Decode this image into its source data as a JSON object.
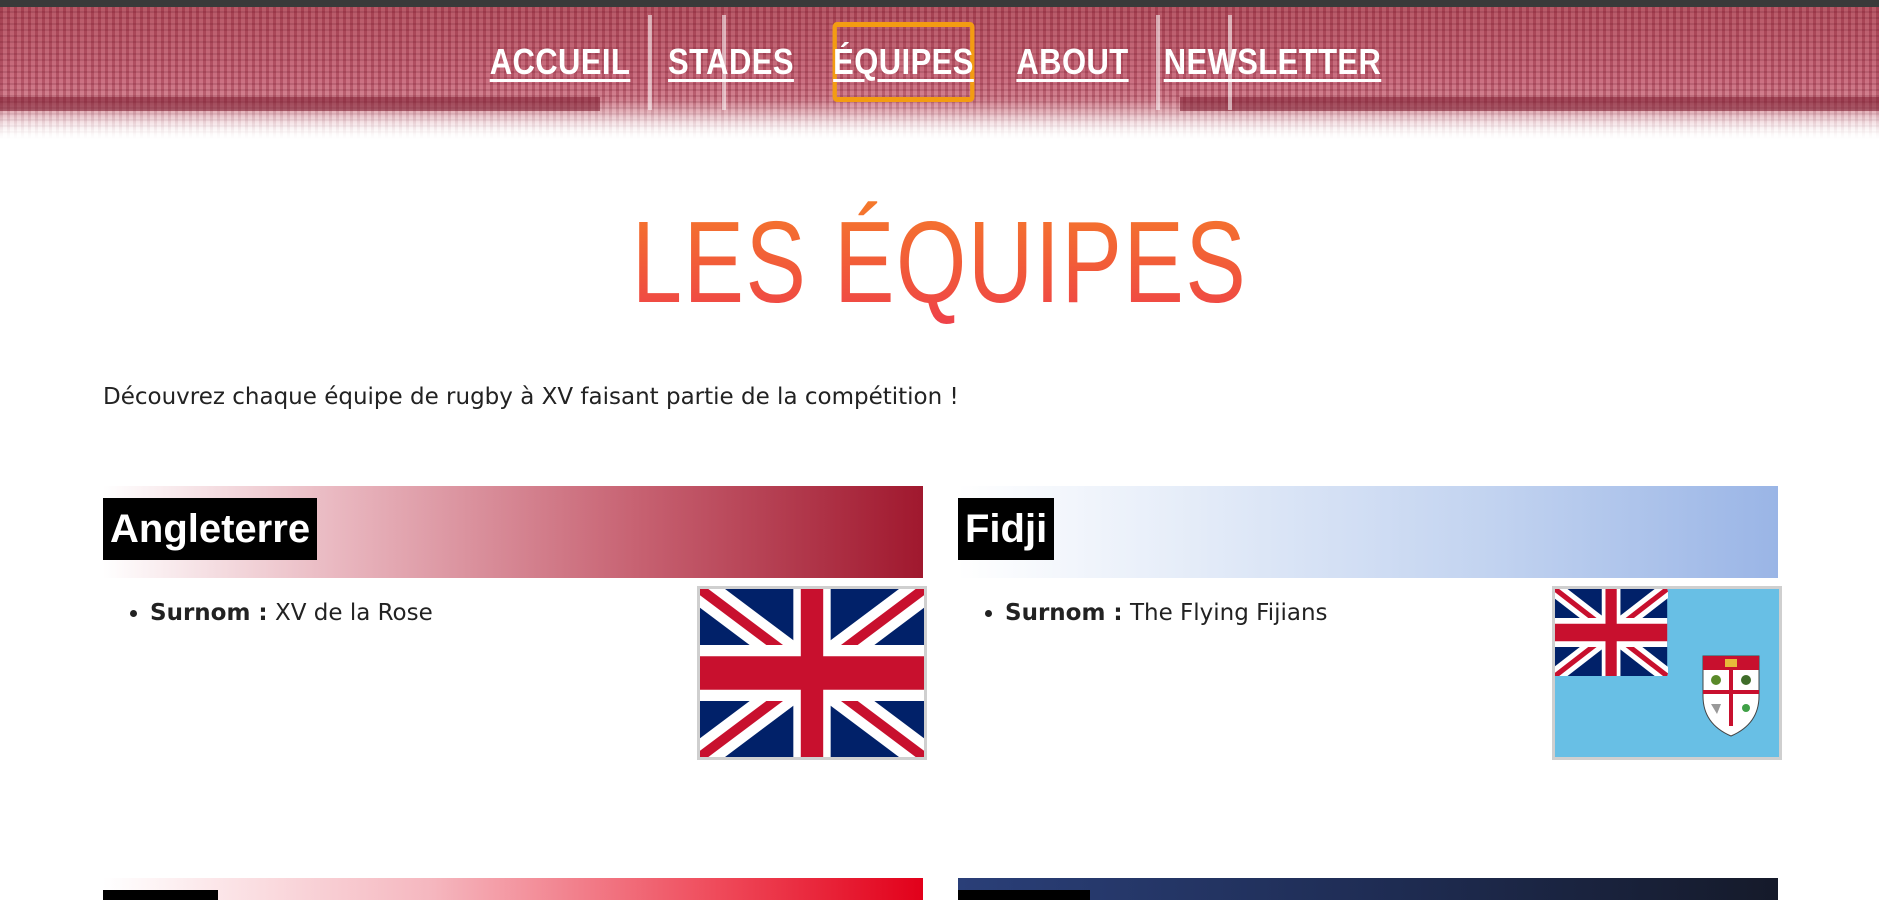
{
  "nav": {
    "items": [
      {
        "label": "ACCUEIL"
      },
      {
        "label": "STADES"
      },
      {
        "label": "ÉQUIPES",
        "active": true
      },
      {
        "label": "ABOUT"
      },
      {
        "label": "NEWSLETTER"
      }
    ]
  },
  "page_title": "LES ÉQUIPES",
  "intro": "Découvrez chaque équipe de rugby à XV faisant partie de la compétition !",
  "teams": [
    {
      "name": "Angleterre",
      "nickname_label": "Surnom :",
      "nickname": "XV de la Rose",
      "flag": "uk-flag-icon",
      "accent": "#a0182e"
    },
    {
      "name": "Fidji",
      "nickname_label": "Surnom :",
      "nickname": "The Flying Fijians",
      "flag": "fiji-flag-icon",
      "accent": "#9ab5e6"
    }
  ],
  "colors": {
    "active_nav_border": "#f39c12",
    "title_gradient_top": "#f57c2a",
    "title_gradient_bottom": "#ee3f4b",
    "banner": "#c8687a"
  }
}
